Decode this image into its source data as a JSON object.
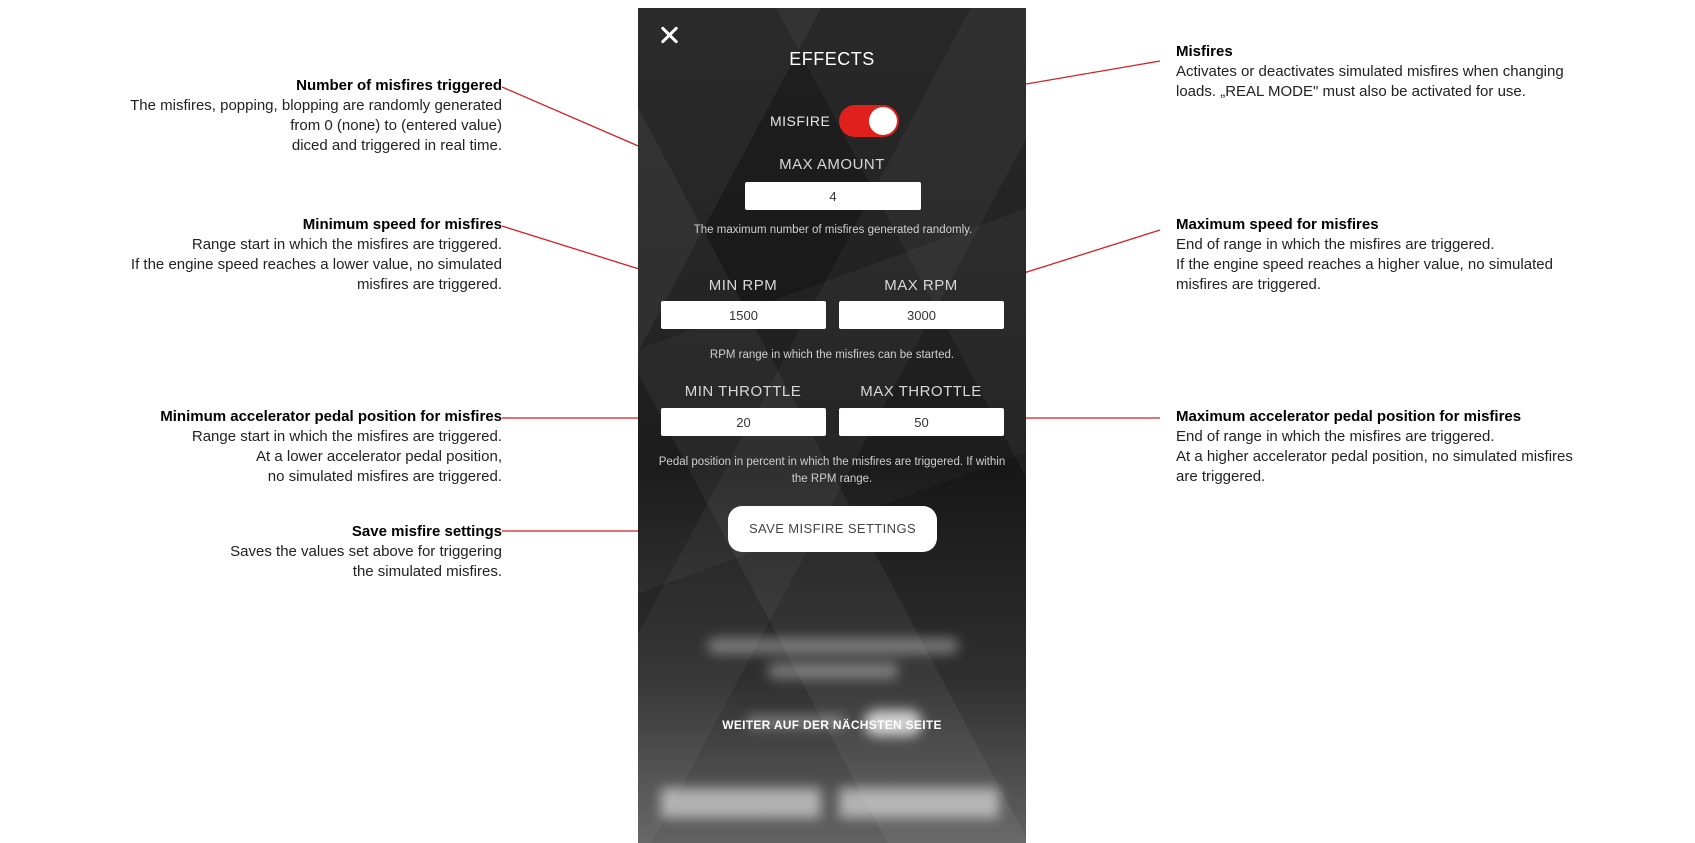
{
  "screen": {
    "title": "EFFECTS",
    "misfire_label": "MISFIRE",
    "misfire_enabled": true,
    "max_amount_label": "MAX AMOUNT",
    "max_amount_value": "4",
    "max_amount_hint": "The maximum number of misfires generated randomly.",
    "min_rpm_label": "MIN RPM",
    "min_rpm_value": "1500",
    "max_rpm_label": "MAX RPM",
    "max_rpm_value": "3000",
    "rpm_hint": "RPM range in which the misfires can be started.",
    "min_throttle_label": "MIN THROTTLE",
    "min_throttle_value": "20",
    "max_throttle_label": "MAX THROTTLE",
    "max_throttle_value": "50",
    "throttle_hint": "Pedal position in percent in which the misfires are triggered. If within the RPM range.",
    "save_button": "SAVE MISFIRE SETTINGS",
    "next_page": "WEITER AUF DER NÄCHSTEN SEITE"
  },
  "annotations": {
    "number_of_misfires": {
      "title": "Number of misfires triggered",
      "lines": [
        "The misfires, popping, blopping are randomly generated",
        "from 0 (none) to (entered value)",
        "diced and triggered in real time."
      ]
    },
    "min_speed": {
      "title": "Minimum speed for misfires",
      "lines": [
        "Range start in which the misfires are triggered.",
        "If the engine speed reaches a lower value, no simulated",
        "misfires are triggered."
      ]
    },
    "min_pedal": {
      "title": "Minimum accelerator pedal position for misfires",
      "lines": [
        "Range start in which the misfires are triggered.",
        "At a lower accelerator pedal position,",
        "no simulated misfires are triggered."
      ]
    },
    "save_settings": {
      "title": "Save misfire settings",
      "lines": [
        "Saves the values set above for triggering",
        "the simulated misfires."
      ]
    },
    "misfires": {
      "title": "Misfires",
      "lines": [
        "Activates or deactivates simulated misfires when changing",
        "loads. „REAL MODE\" must also be activated for use."
      ]
    },
    "max_speed": {
      "title": "Maximum speed for misfires",
      "lines": [
        "End of range in which the misfires are triggered.",
        "If the engine speed reaches a higher value, no simulated",
        "misfires are triggered."
      ]
    },
    "max_pedal": {
      "title": "Maximum accelerator pedal position for misfires",
      "lines": [
        "End of range in which the misfires are triggered.",
        "At a higher accelerator pedal position, no simulated misfires",
        "are triggered."
      ]
    }
  },
  "colors": {
    "accent": "#e0201c",
    "leader_line": "#d21f26"
  }
}
